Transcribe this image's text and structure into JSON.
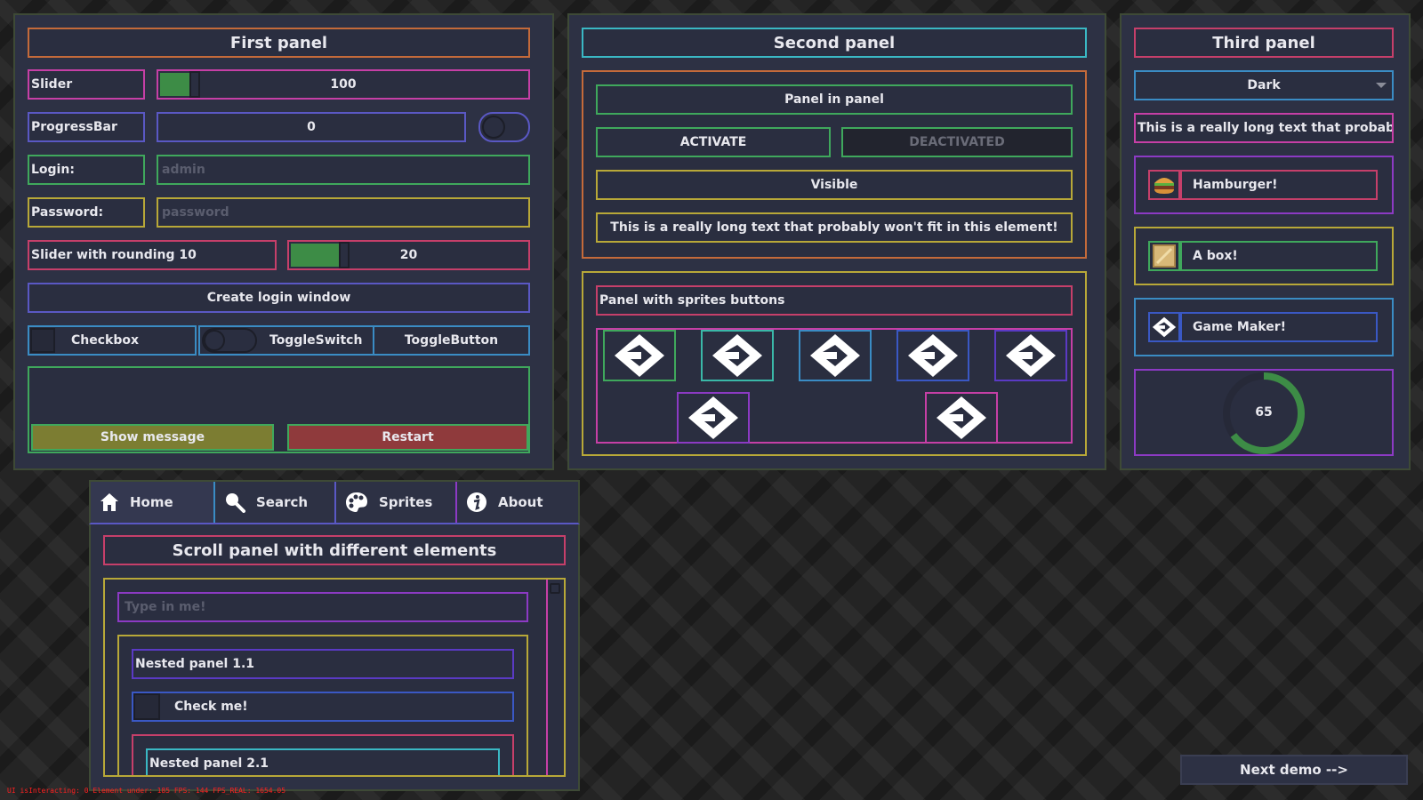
{
  "first_panel": {
    "title": "First panel",
    "slider": {
      "label": "Slider",
      "value": "100",
      "fill_fraction": 0.08
    },
    "progress": {
      "label": "ProgressBar",
      "value": "0"
    },
    "login": {
      "label": "Login:",
      "placeholder": "admin"
    },
    "password": {
      "label": "Password:",
      "placeholder": "password"
    },
    "slider_round": {
      "label": "Slider with rounding 10",
      "value": "20",
      "fill_fraction": 0.2
    },
    "create_login": "Create login window",
    "checkbox": "Checkbox",
    "toggle_switch": "ToggleSwitch",
    "toggle_button": "ToggleButton",
    "show_message": "Show message",
    "restart": "Restart"
  },
  "second_panel": {
    "title": "Second panel",
    "panel_in_panel": "Panel in panel",
    "activate": "ACTIVATE",
    "deactivated": "DEACTIVATED",
    "visible": "Visible",
    "long_text": "This is a really long text that probably won't fit in this element!",
    "sprites_title": "Panel with sprites buttons"
  },
  "third_panel": {
    "title": "Third panel",
    "dropdown": "Dark",
    "long_text": "This is a really long text that probably ...",
    "items": [
      {
        "label": "Hamburger!",
        "icon": "hamburger-icon"
      },
      {
        "label": "A box!",
        "icon": "box-icon"
      },
      {
        "label": "Game Maker!",
        "icon": "gamemaker-icon"
      }
    ],
    "radial_value": "65",
    "radial_fraction": 0.65
  },
  "tabs": [
    {
      "label": "Home",
      "icon": "home-icon"
    },
    {
      "label": "Search",
      "icon": "search-icon"
    },
    {
      "label": "Sprites",
      "icon": "palette-icon"
    },
    {
      "label": "About",
      "icon": "info-icon"
    }
  ],
  "scroll_panel": {
    "title": "Scroll panel with different elements",
    "input_placeholder": "Type in me!",
    "nested_1": "Nested panel 1.1",
    "check_me": "Check me!",
    "nested_2": "Nested panel 2.1"
  },
  "next_demo": "Next demo -->",
  "debug_text": "UI isInteracting: 0 Element under: 185 FPS: 144 FPS_REAL: 1654.05",
  "colors": {
    "panel_bg": "#2d3144",
    "element_bg": "#2a2e40",
    "green_fill": "#3d8c46",
    "olive_button": "#7c7d32",
    "red_button": "#8f3a3c",
    "debug_red": "#ff2020"
  }
}
